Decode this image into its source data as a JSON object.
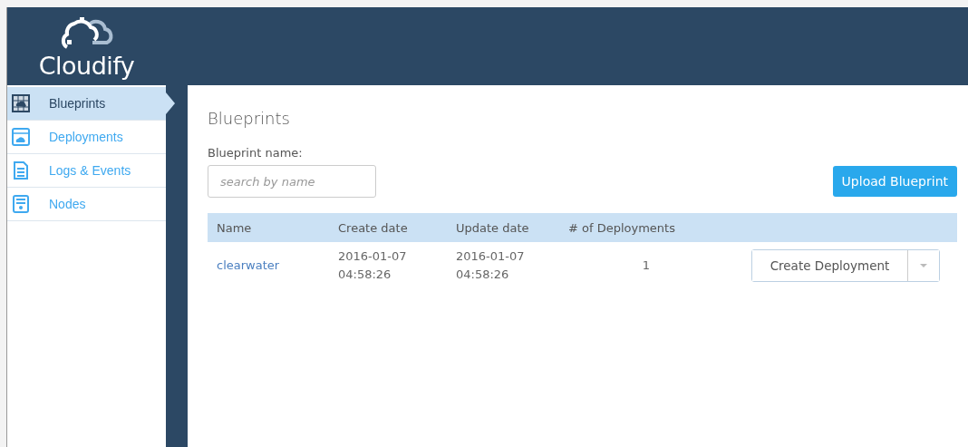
{
  "logo": {
    "text": "Cloudify"
  },
  "sidebar": {
    "items": [
      {
        "label": "Blueprints",
        "kind": "blueprint",
        "selected": true
      },
      {
        "label": "Deployments",
        "kind": "deployment",
        "selected": false
      },
      {
        "label": "Logs & Events",
        "kind": "log",
        "selected": false
      },
      {
        "label": "Nodes",
        "kind": "node",
        "selected": false
      }
    ]
  },
  "page_title": "Blueprints",
  "filter": {
    "label": "Blueprint name:",
    "placeholder": "search by name"
  },
  "upload_button": "Upload Blueprint",
  "table": {
    "columns": [
      "Name",
      "Create date",
      "Update date",
      "# of Deployments"
    ],
    "rows": [
      {
        "name": "clearwater",
        "created": "2016-01-07\n04:58:26",
        "updated": "2016-01-07\n04:58:26",
        "deployments": "1",
        "action": "Create Deployment"
      }
    ]
  }
}
